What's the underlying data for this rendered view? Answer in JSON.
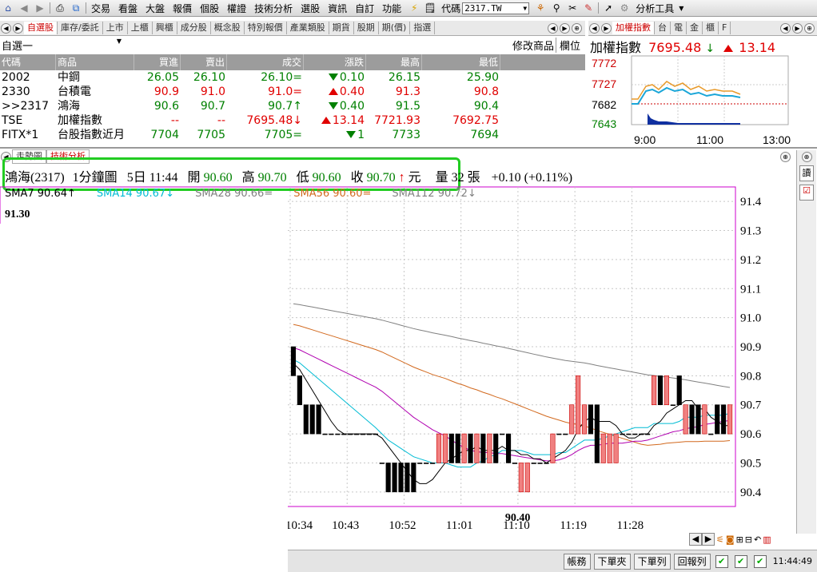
{
  "toolbar": {
    "menus": [
      "交易",
      "看盤",
      "大盤",
      "報價",
      "個股",
      "權證",
      "技術分析",
      "選股",
      "資訊",
      "自訂",
      "功能"
    ],
    "code_label": "代碼",
    "code_value": "2317.TW",
    "analysis_tools": "分析工具"
  },
  "quote_tabs": [
    "自選股",
    "庫存/委託",
    "上市",
    "上櫃",
    "興櫃",
    "成分股",
    "概念股",
    "特別報價",
    "產業類股",
    "期貨",
    "股期",
    "期(價)",
    "指選"
  ],
  "watchlist": {
    "name": "自選一",
    "edit_btn": "修改商品",
    "col_btn": "欄位"
  },
  "quote_table": {
    "headers": [
      "代碼",
      "商品",
      "買進",
      "賣出",
      "成交",
      "漲跌",
      "最高",
      "最低"
    ],
    "rows": [
      {
        "code": "2002",
        "name": "中鋼",
        "bid": "26.05",
        "ask": "26.10",
        "last": "26.10=",
        "chg": "0.10",
        "dir": "down",
        "high": "26.15",
        "low": "25.90",
        "color": "green"
      },
      {
        "code": "2330",
        "name": "台積電",
        "bid": "90.9",
        "ask": "91.0",
        "last": "91.0=",
        "chg": "0.40",
        "dir": "up",
        "high": "91.3",
        "low": "90.8",
        "color": "red"
      },
      {
        "code": ">>2317",
        "name": "鴻海",
        "bid": "90.6",
        "ask": "90.7",
        "last": "90.7↑",
        "chg": "0.40",
        "dir": "down",
        "high": "91.5",
        "low": "90.4",
        "color": "mixed"
      },
      {
        "code": "TSE",
        "name": "加權指數",
        "bid": "--",
        "ask": "--",
        "last": "7695.48↓",
        "chg": "13.14",
        "dir": "up",
        "high": "7721.93",
        "low": "7692.75",
        "color": "red"
      },
      {
        "code": "FITX*1",
        "name": "台股指數近月",
        "bid": "7704",
        "ask": "7705",
        "last": "7705=",
        "chg": "1",
        "dir": "down",
        "high": "7733",
        "low": "7694",
        "color": "green"
      }
    ]
  },
  "mini_tabs": [
    "加權指數",
    "台",
    "電",
    "金",
    "櫃",
    "F"
  ],
  "mini_chart": {
    "name": "加權指數",
    "value": "7695.48",
    "change": "13.14",
    "y_ticks": [
      "7772",
      "7727",
      "7682",
      "7643"
    ],
    "x_ticks": [
      "9:00",
      "11:00",
      "13:00"
    ]
  },
  "chart_tabs": [
    "走勢圖",
    "技術分析"
  ],
  "info_bar": {
    "stock": "鴻海(2317)",
    "period": "1分鐘圖",
    "date": "5日 11:44",
    "open_label": "開",
    "open": "90.60",
    "high_label": "高",
    "high": "90.70",
    "low_label": "低",
    "low": "90.60",
    "close_label": "收",
    "close": "90.70",
    "unit": "元",
    "vol_label": "量",
    "vol": "32 張",
    "change": "+0.10 (+0.11%)"
  },
  "ma_legend": [
    {
      "label": "SMA7 90.64",
      "color": "#000000",
      "arrow": "↑"
    },
    {
      "label": "SMA14 90.67",
      "color": "#00bcd4",
      "arrow": "↓"
    },
    {
      "label": "SMA28 90.66",
      "color": "#808080",
      "arrow": "="
    },
    {
      "label": "SMA56 90.60",
      "color": "#d2691e",
      "arrow": "="
    },
    {
      "label": "SMA112 90.72",
      "color": "#808080",
      "arrow": "↓"
    }
  ],
  "chart_labels": {
    "max_price": "91.30",
    "min_price": "90.40"
  },
  "chart_data": {
    "type": "candlestick",
    "y_ticks": [
      "91.4",
      "91.3",
      "91.2",
      "91.1",
      "91.0",
      "90.9",
      "90.8",
      "90.7",
      "90.6",
      "90.5",
      "90.4"
    ],
    "ylim": [
      90.35,
      91.45
    ],
    "x_ticks": [
      "10:34",
      "10:43",
      "10:52",
      "11:01",
      "11:10",
      "11:19",
      "11:28"
    ],
    "x_tick_index": [
      0,
      9,
      18,
      27,
      36,
      45,
      54
    ],
    "candles": [
      [
        90.9,
        90.8,
        90.9,
        90.8
      ],
      [
        90.8,
        90.7,
        90.8,
        90.7
      ],
      [
        90.7,
        90.6,
        90.7,
        90.6
      ],
      [
        90.7,
        90.6,
        90.7,
        90.6
      ],
      [
        90.7,
        90.6,
        90.7,
        90.6
      ],
      [
        90.6,
        90.6,
        90.6,
        90.6
      ],
      [
        90.6,
        90.6,
        90.6,
        90.6
      ],
      [
        90.6,
        90.6,
        90.6,
        90.6
      ],
      [
        90.6,
        90.6,
        90.6,
        90.6
      ],
      [
        90.6,
        90.6,
        90.6,
        90.6
      ],
      [
        90.6,
        90.6,
        90.6,
        90.6
      ],
      [
        90.6,
        90.6,
        90.6,
        90.6
      ],
      [
        90.6,
        90.6,
        90.6,
        90.6
      ],
      [
        90.6,
        90.6,
        90.6,
        90.6
      ],
      [
        90.5,
        90.5,
        90.5,
        90.5
      ],
      [
        90.5,
        90.4,
        90.5,
        90.4
      ],
      [
        90.5,
        90.4,
        90.5,
        90.4
      ],
      [
        90.5,
        90.4,
        90.5,
        90.4
      ],
      [
        90.5,
        90.4,
        90.5,
        90.4
      ],
      [
        90.5,
        90.4,
        90.5,
        90.4
      ],
      [
        90.5,
        90.5,
        90.5,
        90.5
      ],
      [
        90.5,
        90.5,
        90.5,
        90.5
      ],
      [
        90.5,
        90.5,
        90.5,
        90.5
      ],
      [
        90.5,
        90.6,
        90.6,
        90.5
      ],
      [
        90.5,
        90.6,
        90.6,
        90.5
      ],
      [
        90.6,
        90.5,
        90.6,
        90.5
      ],
      [
        90.6,
        90.5,
        90.6,
        90.5
      ],
      [
        90.5,
        90.6,
        90.6,
        90.5
      ],
      [
        90.6,
        90.5,
        90.6,
        90.5
      ],
      [
        90.5,
        90.6,
        90.6,
        90.5
      ],
      [
        90.6,
        90.5,
        90.6,
        90.5
      ],
      [
        90.5,
        90.6,
        90.6,
        90.5
      ],
      [
        90.6,
        90.5,
        90.6,
        90.5
      ],
      [
        90.6,
        90.6,
        90.6,
        90.6
      ],
      [
        90.6,
        90.5,
        90.6,
        90.5
      ],
      [
        90.5,
        90.5,
        90.5,
        90.5
      ],
      [
        90.4,
        90.5,
        90.5,
        90.4
      ],
      [
        90.4,
        90.5,
        90.5,
        90.4
      ],
      [
        90.5,
        90.5,
        90.5,
        90.5
      ],
      [
        90.5,
        90.5,
        90.5,
        90.5
      ],
      [
        90.5,
        90.5,
        90.5,
        90.5
      ],
      [
        90.5,
        90.6,
        90.6,
        90.5
      ],
      [
        90.6,
        90.6,
        90.6,
        90.6
      ],
      [
        90.6,
        90.6,
        90.6,
        90.6
      ],
      [
        90.6,
        90.7,
        90.7,
        90.6
      ],
      [
        90.6,
        90.8,
        90.8,
        90.6
      ],
      [
        90.6,
        90.7,
        90.7,
        90.6
      ],
      [
        90.7,
        90.6,
        90.7,
        90.6
      ],
      [
        90.7,
        90.5,
        90.7,
        90.5
      ],
      [
        90.5,
        90.6,
        90.6,
        90.5
      ],
      [
        90.5,
        90.6,
        90.6,
        90.5
      ],
      [
        90.5,
        90.6,
        90.6,
        90.5
      ],
      [
        90.6,
        90.6,
        90.6,
        90.6
      ],
      [
        90.6,
        90.6,
        90.6,
        90.6
      ],
      [
        90.6,
        90.6,
        90.6,
        90.6
      ],
      [
        90.6,
        90.6,
        90.6,
        90.6
      ],
      [
        90.6,
        90.6,
        90.6,
        90.6
      ],
      [
        90.7,
        90.8,
        90.8,
        90.7
      ],
      [
        90.8,
        90.7,
        90.8,
        90.7
      ],
      [
        90.7,
        90.8,
        90.8,
        90.7
      ],
      [
        90.7,
        90.7,
        90.7,
        90.7
      ],
      [
        90.8,
        90.7,
        90.8,
        90.7
      ],
      [
        90.6,
        90.7,
        90.7,
        90.6
      ],
      [
        90.7,
        90.6,
        90.7,
        90.6
      ],
      [
        90.7,
        90.6,
        90.7,
        90.6
      ],
      [
        90.6,
        90.7,
        90.7,
        90.6
      ],
      [
        90.6,
        90.6,
        90.6,
        90.6
      ],
      [
        90.7,
        90.6,
        90.7,
        90.6
      ],
      [
        90.7,
        90.6,
        90.7,
        90.6
      ],
      [
        90.6,
        90.7,
        90.7,
        90.6
      ]
    ]
  },
  "bottom_buttons": [
    "帳務",
    "下單夾",
    "下單列",
    "回報列"
  ],
  "clock": "11:44:49",
  "colors": {
    "accent_red": "#e00000",
    "accent_green": "#008000",
    "highlight_box": "#22cc22",
    "chart_border": "#cc00cc"
  }
}
